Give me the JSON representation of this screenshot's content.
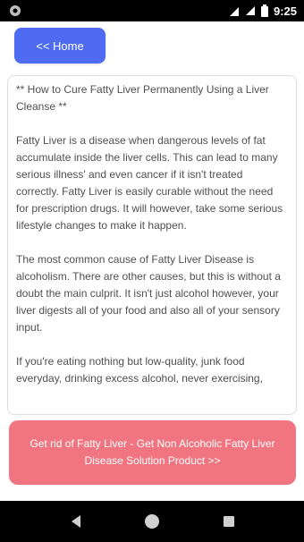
{
  "status_bar": {
    "time": "9:25",
    "icons": [
      "notification-dot-icon",
      "wifi-icon",
      "signal-icon",
      "battery-icon"
    ]
  },
  "home_button": {
    "label": "<< Home"
  },
  "article": {
    "paragraphs": [
      "** How to Cure Fatty Liver Permanently Using a Liver Cleanse **",
      "Fatty Liver is a disease when dangerous levels of fat accumulate inside the liver cells. This can lead to many serious illness' and even cancer if it isn't treated correctly. Fatty Liver is easily curable without the need for prescription drugs. It will however, take some serious lifestyle changes to make it happen.",
      "The most common cause of Fatty Liver Disease is alcoholism. There are other causes, but this is without a doubt the main culprit. It isn't just alcohol however, your liver digests all of your food and also all of your sensory input.",
      "If you're eating nothing but low-quality, junk food everyday, drinking excess alcohol, never exercising,"
    ]
  },
  "cta": {
    "label": "Get rid of Fatty Liver - Get Non Alcoholic Fatty Liver Disease Solution Product >>"
  },
  "nav_bar": {
    "icons": [
      "back-icon",
      "home-icon",
      "recents-icon"
    ]
  },
  "colors": {
    "home_button": "#4f6bf2",
    "cta_button": "#f07581",
    "bars": "#000000"
  }
}
